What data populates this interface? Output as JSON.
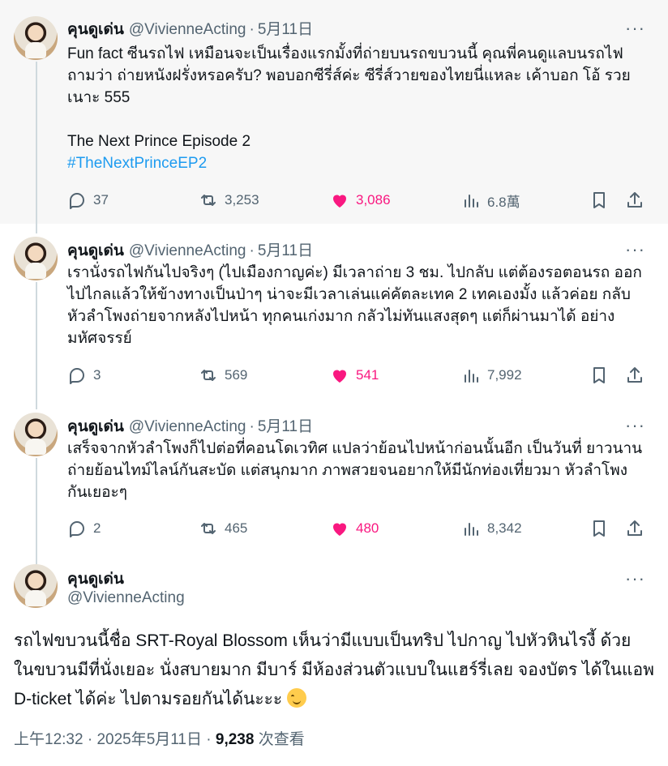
{
  "author": {
    "name": "คุนดูเด่น",
    "handle": "@VivienneActing"
  },
  "separator": "·",
  "more_label": "···",
  "replies": [
    {
      "date": "5月11日",
      "text": "Fun fact ซีนรถไฟ เหมือนจะเป็นเรื่องแรกมั้งที่ถ่ายบนรถขบวนนี้ คุณพี่คนดูแลบนรถไฟ ถามว่า ถ่ายหนังฝรั่งหรอครับ? พอบอกซีรี่ส์ค่ะ ซีรี่ส์วายของไทยนี่แหละ เค้าบอก โอ้ รวย เนาะ 555\n\nThe Next Prince Episode 2",
      "hashtag": "#TheNextPrinceEP2",
      "stats": {
        "replies": "37",
        "reposts": "3,253",
        "likes": "3,086",
        "views": "6.8萬"
      }
    },
    {
      "date": "5月11日",
      "text": "เรานั่งรถไฟกันไปจริงๆ (ไปเมืองกาญค่ะ) มีเวลาถ่าย 3 ชม. ไปกลับ แต่ต้องรอตอนรถ ออกไปไกลแล้วให้ข้างทางเป็นป่าๆ น่าจะมีเวลาเล่นแค่คัตละเทค 2 เทคเองมั้ง แล้วค่อย กลับหัวลำโพงถ่ายจากหลังไปหน้า ทุกคนเก่งมาก กลัวไม่ทันแสงสุดๆ แต่ก็ผ่านมาได้ อย่างมหัศจรรย์",
      "stats": {
        "replies": "3",
        "reposts": "569",
        "likes": "541",
        "views": "7,992"
      }
    },
    {
      "date": "5月11日",
      "text": "เสร็จจากหัวลำโพงก็ไปต่อที่คอนโดเวทิศ แปลว่าย้อนไปหน้าก่อนนั้นอีก เป็นวันที่ ยาวนานถ่ายย้อนไทม์ไลน์กันสะบัด แต่สนุกมาก ภาพสวยจนอยากให้มีนักท่องเที่ยวมา หัวลำโพงกันเยอะๆ",
      "stats": {
        "replies": "2",
        "reposts": "465",
        "likes": "480",
        "views": "8,342"
      }
    }
  ],
  "main_tweet": {
    "text": "รถไฟขบวนนี้ชื่อ SRT-Royal Blossom เห็นว่ามีแบบเป็นทริป ไปกาญ ไปหัวหินไรงี้ ด้วย ในขบวนมีที่นั่งเยอะ นั่งสบายมาก มีบาร์ มีห้องส่วนตัวแบบในแฮร์รี่เลย จองบัตร ได้ในแอพ D-ticket ได้ค่ะ ไปตามรอยกันได้นะะะ",
    "emoji": "smiling-face-icon",
    "time": "上午12:32",
    "date": "2025年5月11日",
    "views": "9,238",
    "views_label": "次查看"
  },
  "colors": {
    "accent": "#1d9bf0",
    "like": "#f91880",
    "muted": "#536471",
    "highlight_bg": "#f7f7f7"
  }
}
